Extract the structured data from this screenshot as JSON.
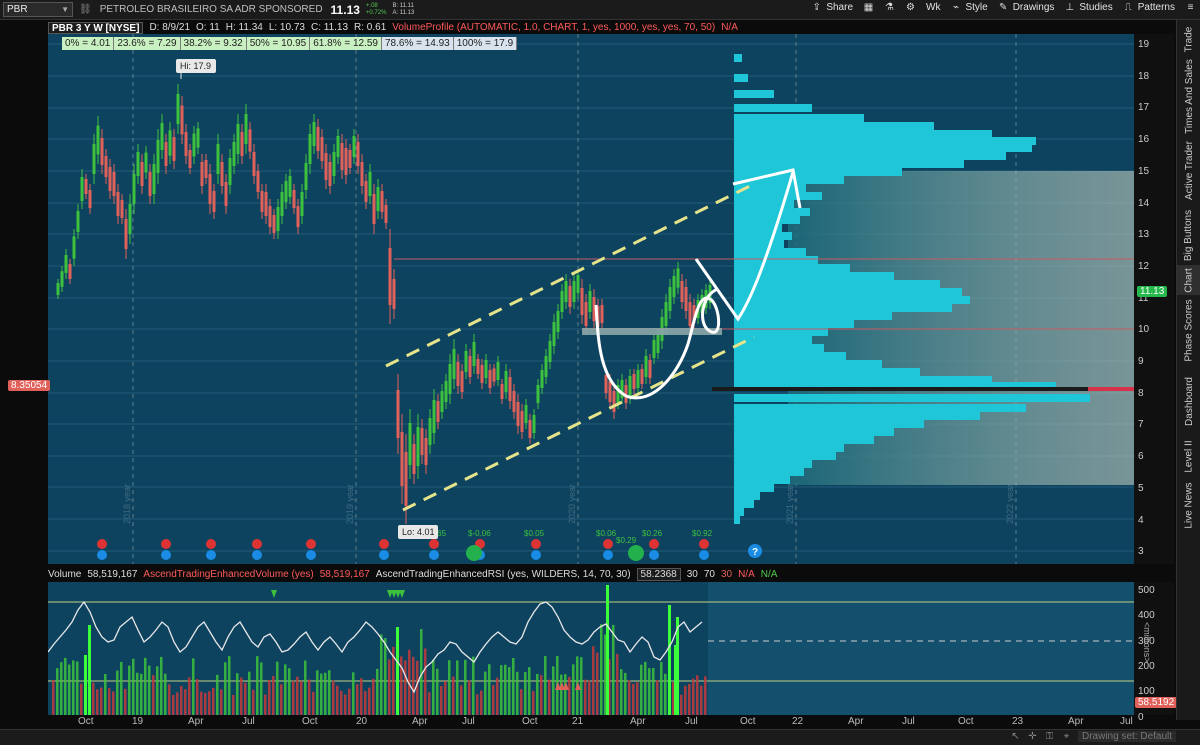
{
  "toolbar": {
    "symbol": "PBR",
    "company": "PETROLEO BRASILEIRO SA ADR SPONSORED",
    "last": "11.13",
    "change": "+.08",
    "change_pct": "+0.72%",
    "bid": "B: 11.11",
    "ask": "A: 11.13",
    "buttons": [
      "Share",
      "Wk",
      "Style",
      "Drawings",
      "Studies",
      "Patterns"
    ]
  },
  "header": {
    "title": "PBR 3 Y W [NYSE]",
    "date": "D: 8/9/21",
    "open": "O: 11",
    "high": "H: 11.34",
    "low": "L: 10.73",
    "close": "C: 11.13",
    "range": "R: 0.61",
    "study": "VolumeProfile (AUTOMATIC, 1.0, CHART, 1, yes, 1000, yes, yes, 70, 50)",
    "study_na": "N/A"
  },
  "fib_levels": [
    "0% = 4.01",
    "23.6% = 7.29",
    "38.2% = 9.32",
    "50% = 10.95",
    "61.8% = 12.59",
    "78.6% = 14.93",
    "100% = 17.9"
  ],
  "annotations": {
    "hi": "Hi: 17.9",
    "lo": "Lo: 4.01",
    "help": "?",
    "dividends": [
      "$0.65",
      "$-0.06",
      "$0.05",
      "$0.06",
      "$0.26",
      "$0.92",
      "$0.29"
    ]
  },
  "price_axis": [
    "19",
    "18",
    "17",
    "16",
    "15",
    "14",
    "13",
    "12",
    "11",
    "10",
    "9",
    "8",
    "7",
    "6",
    "5",
    "4",
    "3"
  ],
  "left_price_tag": "8.35054",
  "last_price_tag": "11.13",
  "year_marks": [
    "2018 year",
    "2019 year",
    "2020 year",
    "2021 year",
    "2022 year"
  ],
  "volume_header": {
    "label": "Volume",
    "value": "58,519,167",
    "study": "AscendTradingEnhancedVolume (yes)",
    "study_value": "58,519,167",
    "rsi": "AscendTradingEnhancedRSI (yes, WILDERS, 14, 70, 30)",
    "rsi_value": "58.2368",
    "v1": "30",
    "v2": "70",
    "v3": "30",
    "na1": "N/A",
    "na2": "N/A"
  },
  "lower_axis": [
    "500",
    "400",
    "300",
    "200",
    "100",
    "0"
  ],
  "lower_axis_unit": "<millions>",
  "lower_price_tag": "58.5192",
  "time_axis": [
    "Oct",
    "19",
    "Apr",
    "Jul",
    "Oct",
    "20",
    "Apr",
    "Jul",
    "Oct",
    "21",
    "Apr",
    "Jul",
    "Oct",
    "22",
    "Apr",
    "Jul",
    "Oct",
    "23",
    "Apr",
    "Jul"
  ],
  "side_tabs": [
    "Trade",
    "Times And Sales",
    "Active Trader",
    "Big Buttons",
    "Chart",
    "Phase Scores",
    "Dashboard",
    "Level II",
    "Live News"
  ],
  "status": {
    "drawing_set": "Drawing set: Default"
  },
  "colors": {
    "bg": "#0e4360",
    "up": "#3cc23c",
    "down": "#e0605a",
    "profile": "#1ec6d8",
    "trend": "#e6e48a"
  }
}
